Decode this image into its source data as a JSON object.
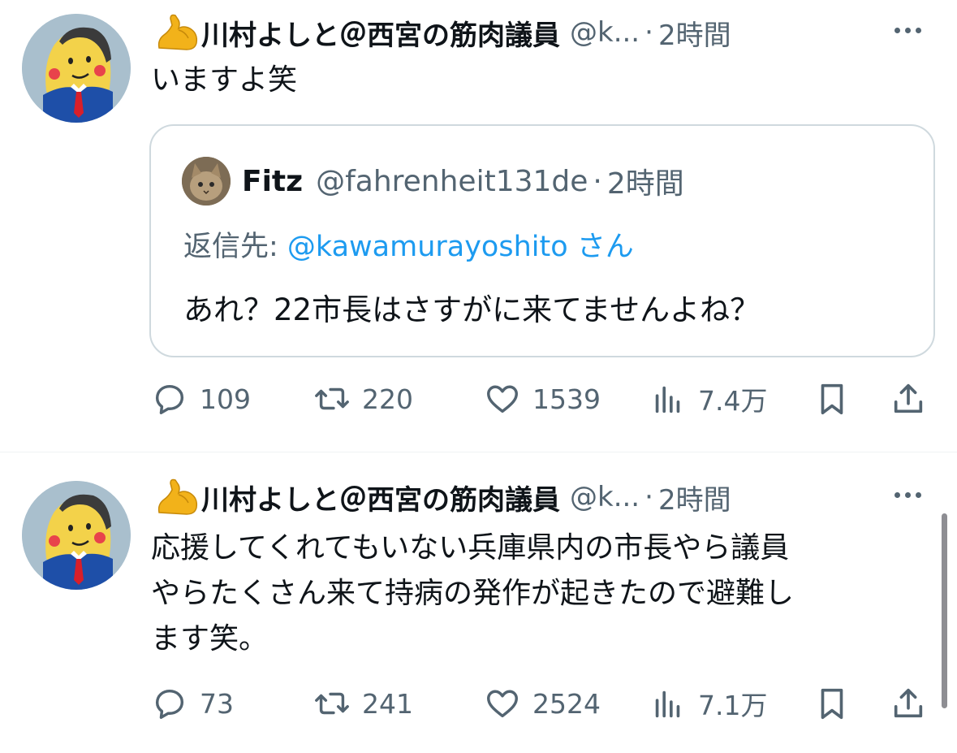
{
  "colors": {
    "text": "#0f1419",
    "secondary": "#536471",
    "accent": "#1d9bf0",
    "border": "#cfd9de"
  },
  "tweets": [
    {
      "author": {
        "emoji_icon": "flexed-biceps-icon",
        "name": "川村よしと＠西宮の筋肉議員",
        "handle": "@k...",
        "separator": "·",
        "time": "2時間"
      },
      "text_lines": [
        "いますよ笑"
      ],
      "quote": {
        "name": "Fitz",
        "handle": "@fahrenheit131de",
        "separator": "·",
        "time": "2時間",
        "reply_prefix": "返信先: ",
        "reply_mention": "@kawamurayoshito",
        "reply_suffix": " さん",
        "text": "あれ？22市長はさすがに来てませんよね？"
      },
      "stats": {
        "replies": "109",
        "retweets": "220",
        "likes": "1539",
        "views": "7.4万"
      }
    },
    {
      "author": {
        "emoji_icon": "flexed-biceps-icon",
        "name": "川村よしと＠西宮の筋肉議員",
        "handle": "@k...",
        "separator": "·",
        "time": "2時間"
      },
      "text_lines": [
        "応援してくれてもいない兵庫県内の市長やら議員",
        "やらたくさん来て持病の発作が起きたので避難し",
        "ます笑。"
      ],
      "stats": {
        "replies": "73",
        "retweets": "241",
        "likes": "2524",
        "views": "7.1万"
      }
    }
  ]
}
